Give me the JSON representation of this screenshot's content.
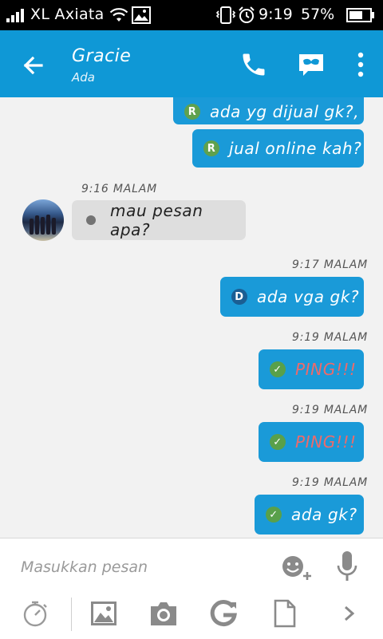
{
  "status_bar": {
    "carrier": "XL Axiata",
    "time": "9:19",
    "battery": "57%",
    "icons": [
      "signal-icon",
      "wifi-icon",
      "gallery-notification-icon",
      "vibrate-icon",
      "alarm-icon",
      "battery-icon"
    ]
  },
  "header": {
    "contact_name": "Gracie",
    "contact_status": "Ada",
    "icons": [
      "back-arrow-icon",
      "phone-icon",
      "emoticon-mask-icon",
      "more-vert-icon"
    ]
  },
  "messages": [
    {
      "direction": "outgoing",
      "badge": "R",
      "text": "ada yg dijual gk?,"
    },
    {
      "direction": "outgoing",
      "badge": "R",
      "text": "jual online kah?"
    },
    {
      "direction": "incoming",
      "timestamp": "9:16 MALAM",
      "text": "mau pesan apa?"
    },
    {
      "direction": "outgoing",
      "timestamp": "9:17 MALAM",
      "badge": "D",
      "text": "ada vga gk?"
    },
    {
      "direction": "outgoing",
      "timestamp": "9:19 MALAM",
      "badge": "check",
      "text": "PING!!!"
    },
    {
      "direction": "outgoing",
      "timestamp": "9:19 MALAM",
      "badge": "check",
      "text": "PING!!!"
    },
    {
      "direction": "outgoing",
      "timestamp": "9:19 MALAM",
      "badge": "check",
      "text": "ada gk?"
    }
  ],
  "input": {
    "placeholder": "Masukkan pesan",
    "value": ""
  },
  "toolbar": {
    "icons": [
      "timer-icon",
      "image-icon",
      "camera-icon",
      "refresh-g-icon",
      "file-icon",
      "chevron-right-icon"
    ]
  },
  "colors": {
    "accent": "#0f98d6",
    "bubble_out": "#1a9ad8",
    "bubble_in": "#dedede",
    "ping_text": "#ee6a6a",
    "badge_green": "#5fa14e",
    "badge_blue": "#1b5e93"
  }
}
